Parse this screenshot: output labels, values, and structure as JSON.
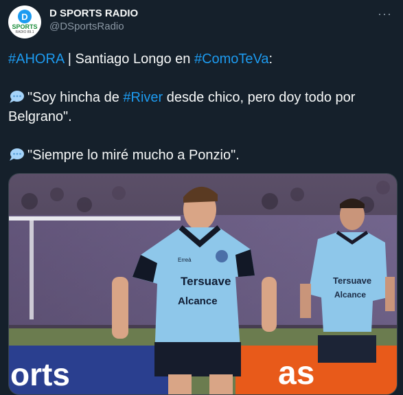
{
  "account": {
    "display_name": "D SPORTS RADIO",
    "handle": "@DSportsRadio",
    "avatar": {
      "letter": "D",
      "text": "SPORTS",
      "sub": "RADIO 89.1"
    }
  },
  "tweet": {
    "line1": {
      "hashtag1": "#AHORA",
      "text1": " | Santiago Longo en ",
      "hashtag2": "#ComoTeVa",
      "text2": ":"
    },
    "quote1": {
      "text1": "\"Soy hincha de ",
      "hashtag": "#River",
      "text2": " desde chico, pero doy todo por Belgrano\"."
    },
    "quote2": {
      "text": "\"Siempre lo miré mucho a Ponzio\"."
    }
  },
  "media": {
    "shirt_text1": "Tersuave",
    "shirt_text2": "Alcance",
    "shirt_text3": "Tersuave",
    "shirt_text4": "Alcance",
    "brand_text": "Erreà",
    "board_text1": "orts",
    "board_text2": "as"
  },
  "colors": {
    "background": "#15202b",
    "accent": "#1d9bf0",
    "muted": "#8b98a5"
  }
}
